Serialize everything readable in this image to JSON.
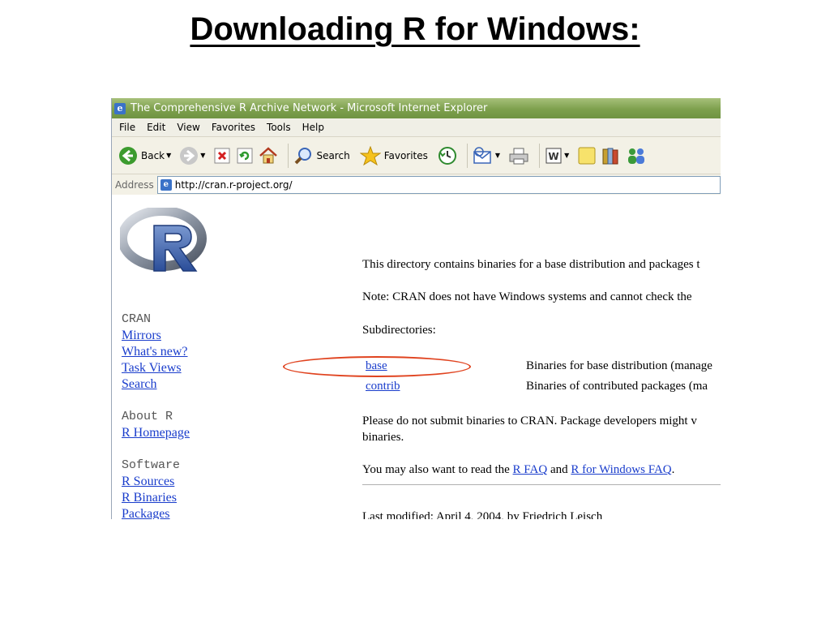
{
  "slide": {
    "title": "Downloading R for Windows:"
  },
  "window": {
    "title": "The Comprehensive R Archive Network - Microsoft Internet Explorer"
  },
  "menu": [
    "File",
    "Edit",
    "View",
    "Favorites",
    "Tools",
    "Help"
  ],
  "toolbar": {
    "back": "Back",
    "search": "Search",
    "favorites": "Favorites"
  },
  "address": {
    "label": "Address",
    "url": "http://cran.r-project.org/"
  },
  "sidebar": {
    "cran_heading": "CRAN",
    "cran_links": [
      "Mirrors",
      "What's new?",
      "Task Views",
      "Search"
    ],
    "about_heading": "About R",
    "about_links": [
      "R Homepage"
    ],
    "software_heading": "Software",
    "software_links": [
      "R Sources",
      "R Binaries",
      "Packages"
    ]
  },
  "main": {
    "intro": "This directory contains binaries for a base distribution and packages t",
    "note": "Note: CRAN does not have Windows systems and cannot check the",
    "subdirs_label": "Subdirectories:",
    "subdirs": [
      {
        "name": "base",
        "desc": "Binaries for base distribution (manage"
      },
      {
        "name": "contrib",
        "desc": "Binaries of contributed packages (ma"
      }
    ],
    "please_line1": "Please do not submit binaries to CRAN. Package developers might v",
    "please_line2": "binaries.",
    "faq_prefix": "You may also want to read the ",
    "faq_link1": "R FAQ",
    "faq_mid": " and ",
    "faq_link2": "R for Windows FAQ",
    "faq_suffix": ".",
    "last_modified": "Last modified: April 4, 2004, by Friedrich Leisch"
  },
  "colors": {
    "link": "#1a3dcc",
    "highlight_ellipse": "#e0431f",
    "titlebar": "#7da04d"
  }
}
